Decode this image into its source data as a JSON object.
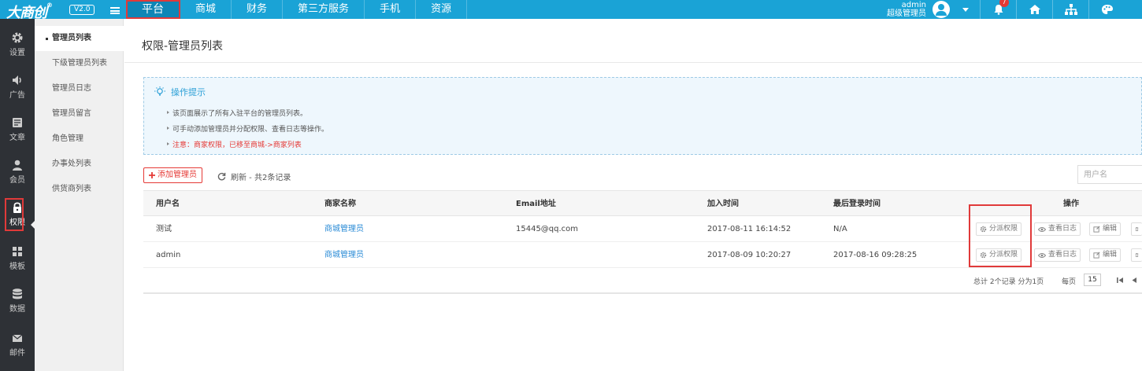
{
  "brand": {
    "logo": "大商创",
    "version": "V2.0"
  },
  "top_nav": [
    {
      "label": "平台",
      "active": true
    },
    {
      "label": "商城"
    },
    {
      "label": "财务"
    },
    {
      "label": "第三方服务"
    },
    {
      "label": "手机"
    },
    {
      "label": "资源"
    }
  ],
  "user": {
    "name": "admin",
    "role": "超级管理员"
  },
  "notifications": {
    "count": "7"
  },
  "top_icons": [
    "bell-icon",
    "home-icon",
    "sitemap-icon",
    "palette-icon"
  ],
  "sidebar": [
    {
      "label": "设置",
      "icon": "gear-icon"
    },
    {
      "label": "广告",
      "icon": "speaker-icon"
    },
    {
      "label": "文章",
      "icon": "article-icon"
    },
    {
      "label": "会员",
      "icon": "user-icon"
    },
    {
      "label": "权限",
      "icon": "lock-icon",
      "active": true
    },
    {
      "label": "模板",
      "icon": "grid-icon"
    },
    {
      "label": "数据",
      "icon": "database-icon"
    },
    {
      "label": "邮件",
      "icon": "mail-icon"
    }
  ],
  "submenu": [
    {
      "label": "管理员列表",
      "active": true
    },
    {
      "label": "下级管理员列表"
    },
    {
      "label": "管理员日志"
    },
    {
      "label": "管理员留言"
    },
    {
      "label": "角色管理"
    },
    {
      "label": "办事处列表"
    },
    {
      "label": "供货商列表"
    }
  ],
  "page": {
    "title": "权限-管理员列表"
  },
  "tips": {
    "heading": "操作提示",
    "lines": [
      "该页面展示了所有入驻平台的管理员列表。",
      "可手动添加管理员并分配权限、查看日志等操作。",
      "注意：商家权限，已移至商城->商家列表"
    ]
  },
  "toolbar": {
    "add_label": "添加管理员",
    "refresh_label": "刷新 - 共2条记录",
    "search_placeholder": "用户名"
  },
  "table": {
    "headers": [
      "用户名",
      "商家名称",
      "Email地址",
      "加入时间",
      "最后登录时间",
      "操作"
    ],
    "rows": [
      {
        "username": "测试",
        "shop": "商城管理员",
        "email": "15445@qq.com",
        "joined": "2017-08-11 16:14:52",
        "last_login": "N/A"
      },
      {
        "username": "admin",
        "shop": "商城管理员",
        "email": "",
        "joined": "2017-08-09 10:20:27",
        "last_login": "2017-08-16 09:28:25"
      }
    ],
    "actions": {
      "assign": "分派权限",
      "log": "查看日志",
      "edit": "编辑"
    }
  },
  "pagination": {
    "summary": "总计 2个记录 分为1页",
    "per_page_label": "每页",
    "per_page": "15"
  },
  "colors": {
    "topbar": "#1aa3d6",
    "sidebar": "#2e3136",
    "highlight": "#e03a3a",
    "link": "#2a8bd6"
  }
}
